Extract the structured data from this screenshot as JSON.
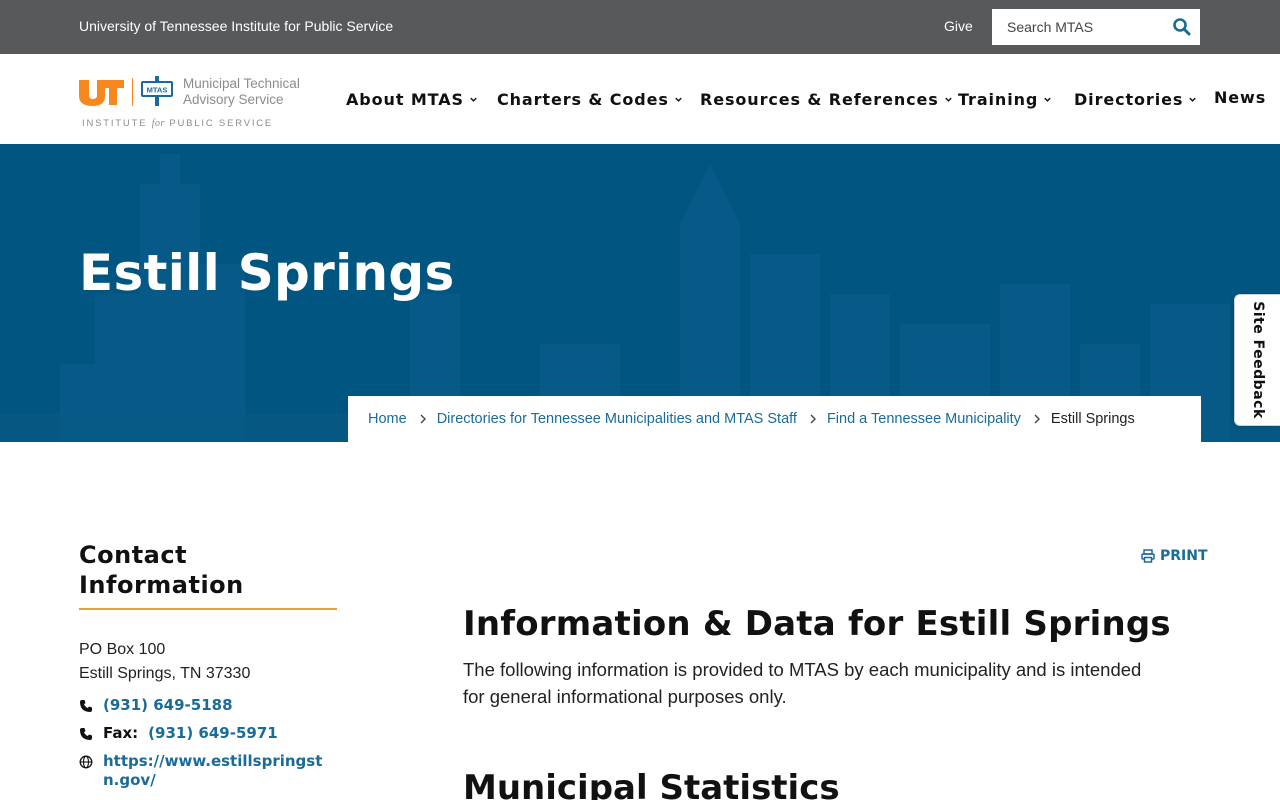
{
  "topbar": {
    "institute": "University of Tennessee Institute for Public Service",
    "give": "Give",
    "search_placeholder": "Search MTAS"
  },
  "logo": {
    "ut_text": "UT",
    "mtas_badge": "MTAS",
    "org_line1": "Municipal Technical",
    "org_line2": "Advisory Service",
    "ips_pre": "INSTITUTE",
    "ips_for": "for",
    "ips_post": "PUBLIC SERVICE"
  },
  "nav": {
    "items": [
      {
        "label": "About MTAS"
      },
      {
        "label": "Charters & Codes"
      },
      {
        "label": "Resources & References"
      },
      {
        "label": "Training"
      },
      {
        "label": "Directories"
      },
      {
        "label": "News"
      }
    ]
  },
  "hero": {
    "title": "Estill Springs"
  },
  "breadcrumb": {
    "items": [
      {
        "label": "Home"
      },
      {
        "label": "Directories for Tennessee Municipalities and MTAS Staff"
      },
      {
        "label": "Find a Tennessee Municipality"
      }
    ],
    "current": "Estill Springs"
  },
  "feedback": {
    "label": "Site Feedback"
  },
  "sidebar": {
    "heading_line1": "Contact",
    "heading_line2": "Information",
    "address_line1": "PO Box 100",
    "address_line2": "Estill Springs, TN 37330",
    "phone": "(931) 649-5188",
    "fax_label": "Fax:",
    "fax": "(931) 649-5971",
    "website": "https://www.estillspringstn.gov/"
  },
  "main": {
    "print": "PRINT",
    "title": "Information & Data for Estill Springs",
    "description": "The following information is provided to MTAS by each municipality and is intended for general informational purposes only.",
    "section_title": "Municipal Statistics"
  },
  "colors": {
    "topbar": "#58595b",
    "hero": "#005581",
    "link": "#1a6b98",
    "accent_orange": "#f6881f",
    "underline_gold": "#e6a22c"
  },
  "icons": {
    "search": "search-icon",
    "chevron": "chevron-down-icon",
    "breadcrumb_sep": "chevron-right-icon",
    "phone": "phone-icon",
    "fax": "fax-icon",
    "web": "globe-icon",
    "print": "printer-icon"
  }
}
